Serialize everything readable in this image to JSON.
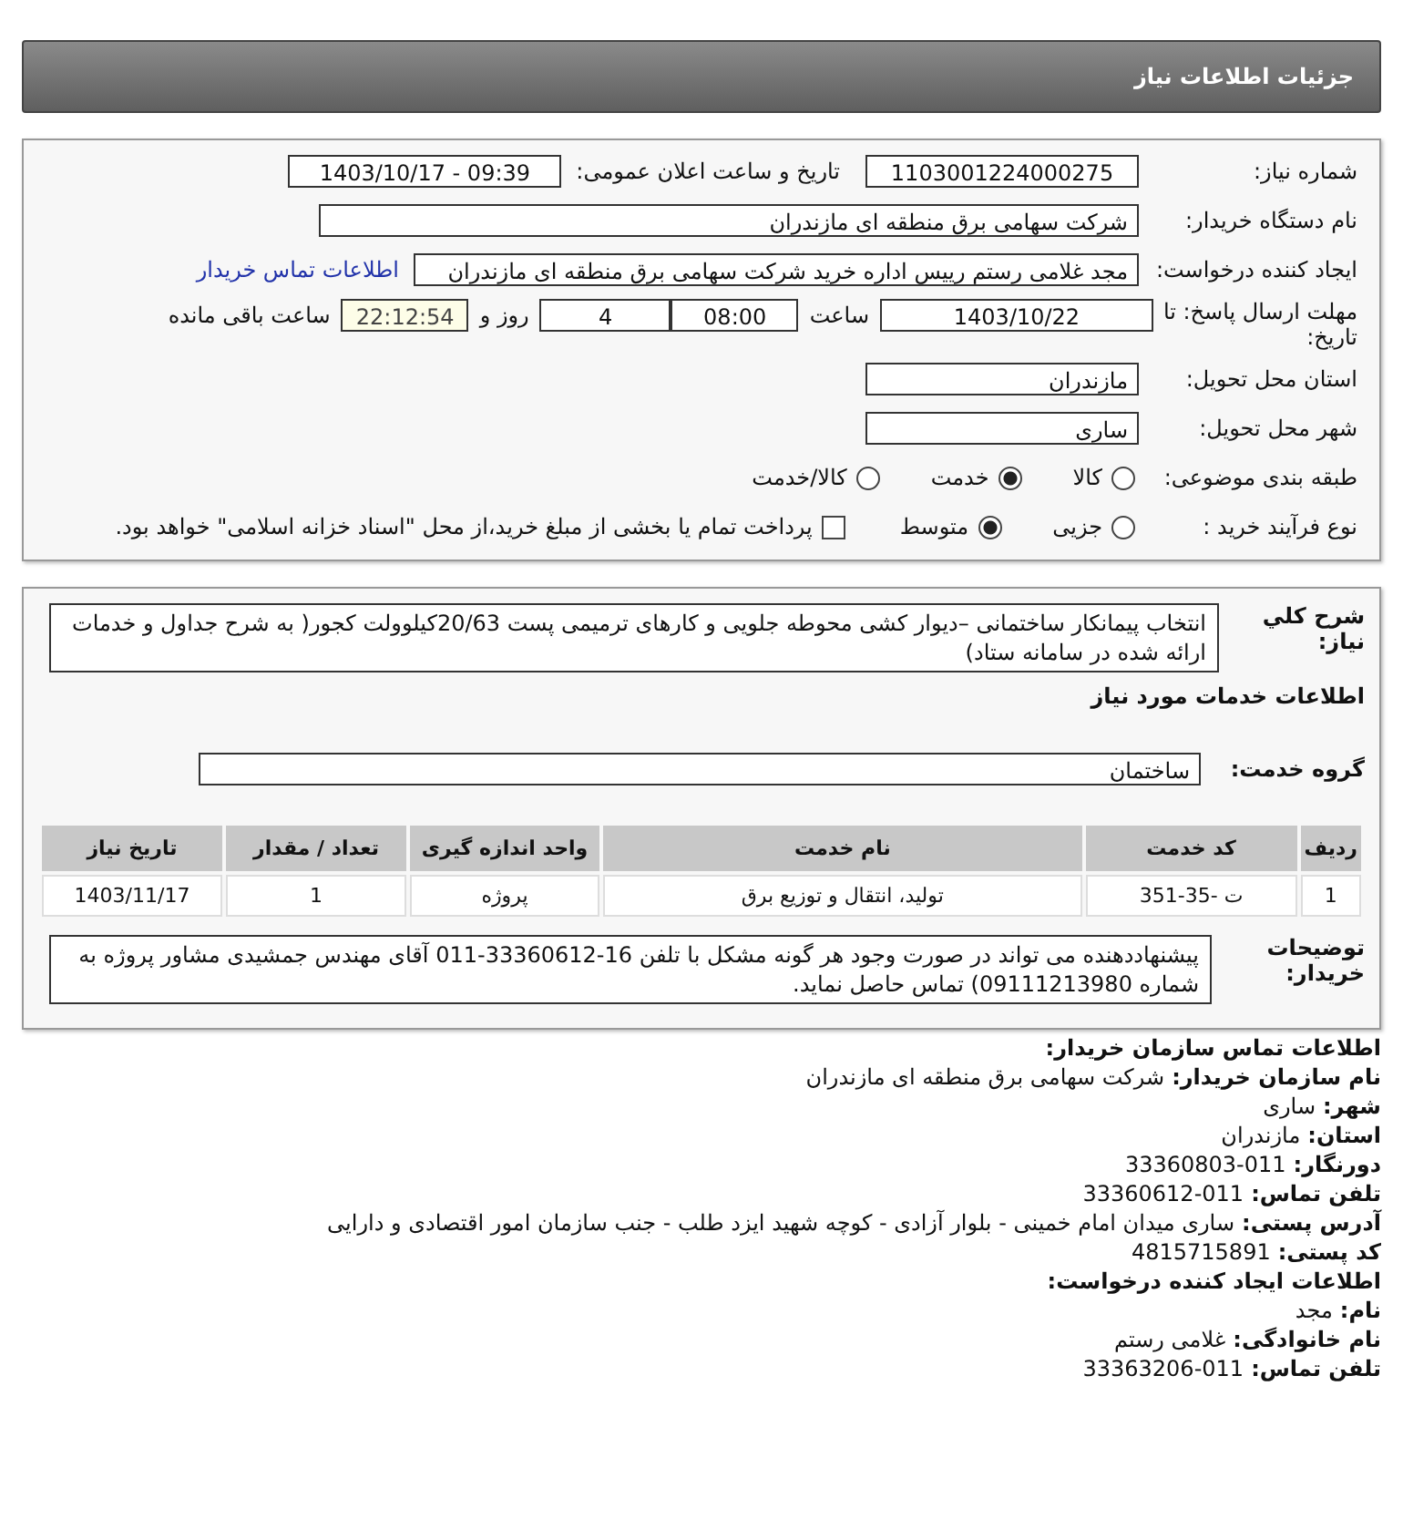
{
  "header": {
    "title": "جزئیات اطلاعات نیاز"
  },
  "need_number": {
    "label": "شماره نیاز:",
    "value": "1103001224000275"
  },
  "announce": {
    "label": "تاریخ و ساعت اعلان عمومی:",
    "value": "1403/10/17 - 09:39"
  },
  "buyer_org": {
    "label": "نام دستگاه خریدار:",
    "value": "شرکت سهامی برق منطقه ای مازندران"
  },
  "creator": {
    "label": "ایجاد کننده درخواست:",
    "value": "مجد غلامی رستم رییس اداره خرید شرکت سهامی برق منطقه ای مازندران",
    "link": "اطلاعات تماس خریدار"
  },
  "deadline": {
    "label": "مهلت ارسال پاسخ: تا تاریخ:",
    "date": "1403/10/22",
    "time_label": "ساعت",
    "time": "08:00",
    "days": "4",
    "days_label": "روز و",
    "remaining": "22:12:54",
    "remaining_label": "ساعت باقی مانده"
  },
  "province": {
    "label": "استان محل تحویل:",
    "value": "مازندران"
  },
  "city": {
    "label": "شهر محل تحویل:",
    "value": "ساری"
  },
  "category": {
    "label": "طبقه بندی موضوعی:",
    "options": [
      {
        "label": "کالا",
        "selected": false
      },
      {
        "label": "خدمت",
        "selected": true
      },
      {
        "label": "کالا/خدمت",
        "selected": false
      }
    ]
  },
  "process": {
    "label": "نوع فرآیند خرید :",
    "options": [
      {
        "label": "جزیی",
        "selected": false
      },
      {
        "label": "متوسط",
        "selected": true
      }
    ],
    "payment": {
      "label": "پرداخت تمام یا بخشی از مبلغ خرید،از محل \"اسناد خزانه اسلامی\" خواهد بود.",
      "checked": false
    }
  },
  "description": {
    "label": "شرح کلي نیاز:",
    "value": "انتخاب پیمانکار ساختمانی –دیوار کشی محوطه جلویی و کارهای ترمیمی پست 20/63کیلوولت کجور( به شرح جداول و خدمات ارائه شده در سامانه ستاد)"
  },
  "services_heading": "اطلاعات خدمات مورد نیاز",
  "service_group": {
    "label": "گروه خدمت:",
    "value": "ساختمان"
  },
  "table": {
    "columns": [
      "ردیف",
      "کد خدمت",
      "نام خدمت",
      "واحد اندازه گیری",
      "تعداد / مقدار",
      "تاریخ نیاز"
    ],
    "rows": [
      [
        "1",
        "ت -35-351",
        "تولید، انتقال و توزیع برق",
        "پروژه",
        "1",
        "1403/11/17"
      ]
    ]
  },
  "notes": {
    "label": "توضیحات خریدار:",
    "value": "پیشنهاددهنده می تواند در صورت وجود هر گونه مشکل با تلفن 16-33360612-011 آقای مهندس جمشیدی مشاور پروژه به شماره 09111213980) تماس حاصل نماید."
  },
  "contacts": [
    {
      "title": "اطلاعات تماس سازمان خریدار:",
      "lines": [
        {
          "label": "نام سازمان خریدار:",
          "value": "شرکت سهامی برق منطقه ای مازندران"
        },
        {
          "label": "شهر:",
          "value": "ساری"
        },
        {
          "label": "استان:",
          "value": "مازندران"
        },
        {
          "label": "دورنگار:",
          "value": "011-33360803"
        },
        {
          "label": "تلفن تماس:",
          "value": "011-33360612"
        },
        {
          "label": "آدرس پستی:",
          "value": "ساری میدان امام خمینی - بلوار آزادی - کوچه شهید ایزد طلب - جنب سازمان امور اقتصادی و دارایی"
        },
        {
          "label": "کد پستی:",
          "value": "4815715891"
        }
      ]
    },
    {
      "title": "اطلاعات ایجاد کننده درخواست:",
      "lines": [
        {
          "label": "نام:",
          "value": "مجد"
        },
        {
          "label": "نام خانوادگی:",
          "value": "غلامی رستم"
        },
        {
          "label": "تلفن تماس:",
          "value": "011-33363206"
        }
      ]
    }
  ]
}
